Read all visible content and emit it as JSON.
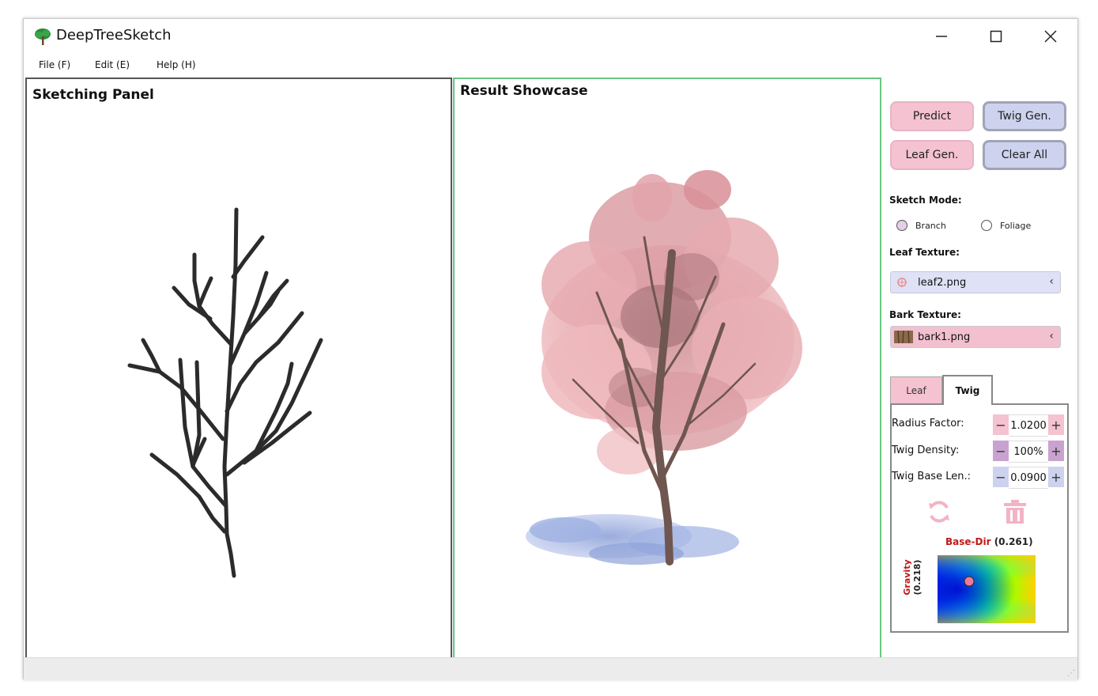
{
  "app": {
    "title": "DeepTreeSketch"
  },
  "window_controls": {
    "minimize": "minimize-icon",
    "maximize": "maximize-icon",
    "close": "close-icon"
  },
  "menu": [
    {
      "label": "File (F)"
    },
    {
      "label": "Edit (E)"
    },
    {
      "label": "Help (H)"
    }
  ],
  "sketch_panel": {
    "title": "Sketching Panel",
    "stroke_color": "#2b2b2b"
  },
  "result_panel": {
    "title": "Result Showcase",
    "border_color": "#68c880"
  },
  "sidebar": {
    "buttons": {
      "predict": "Predict",
      "twig_gen": "Twig Gen.",
      "leaf_gen": "Leaf Gen.",
      "clear_all": "Clear All"
    },
    "sketch_mode": {
      "label": "Sketch Mode:",
      "options": [
        "Branch",
        "Foliage"
      ]
    },
    "leaf_texture": {
      "label": "Leaf Texture:",
      "value": "leaf2.png"
    },
    "bark_texture": {
      "label": "Bark Texture:",
      "value": "bark1.png"
    },
    "tabs": [
      "Leaf",
      "Twig"
    ],
    "active_tab": "Twig",
    "params": [
      {
        "label": "Radius Factor:",
        "value": "1.0200"
      },
      {
        "label": "Twig Density:",
        "value": "100%"
      },
      {
        "label": "Twig Base Len.:",
        "value": "0.0900"
      }
    ],
    "icons": {
      "refresh": "refresh-icon",
      "delete": "trash-icon"
    },
    "base_dir": {
      "label": "Base-Dir",
      "value": "(0.261)"
    },
    "gravity": {
      "label": "Gravity",
      "value": "(0.218)"
    }
  },
  "colors": {
    "pink_button": "#f4c2d0",
    "blue_button": "#cdd3ee",
    "accent_red": "#c01818"
  }
}
